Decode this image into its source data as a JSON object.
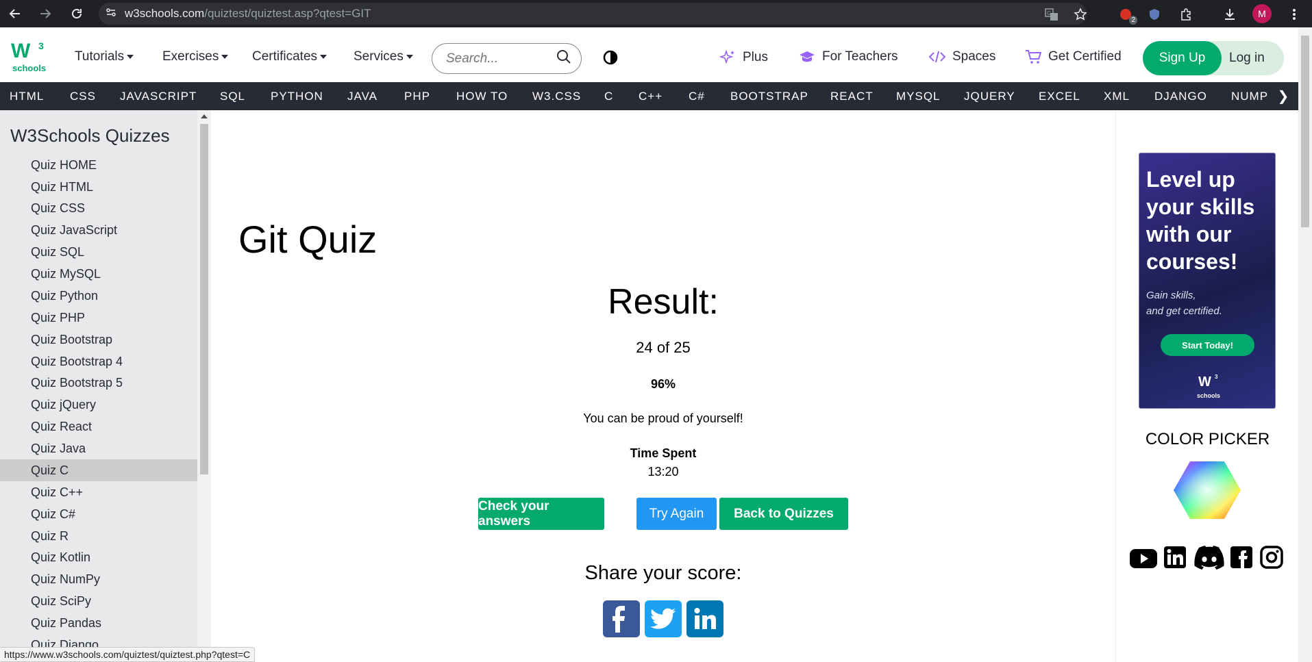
{
  "browser": {
    "url_host": "w3schools.com",
    "url_path": "/quiztest/quiztest.asp?qtest=GIT",
    "extension_badge": "2",
    "profile_initial": "M"
  },
  "topnav": {
    "logo_text": "schools",
    "logo_sup": "3",
    "menus": [
      "Tutorials",
      "Exercises",
      "Certificates",
      "Services"
    ],
    "search_placeholder": "Search...",
    "right_links": [
      "Plus",
      "For Teachers",
      "Spaces",
      "Get Certified"
    ],
    "signup": "Sign Up",
    "login": "Log in"
  },
  "subjects": [
    "HTML",
    "CSS",
    "JAVASCRIPT",
    "SQL",
    "PYTHON",
    "JAVA",
    "PHP",
    "HOW TO",
    "W3.CSS",
    "C",
    "C++",
    "C#",
    "BOOTSTRAP",
    "REACT",
    "MYSQL",
    "JQUERY",
    "EXCEL",
    "XML",
    "DJANGO",
    "NUMPY"
  ],
  "sidebar": {
    "title": "W3Schools Quizzes",
    "items": [
      "Quiz HOME",
      "Quiz HTML",
      "Quiz CSS",
      "Quiz JavaScript",
      "Quiz SQL",
      "Quiz MySQL",
      "Quiz Python",
      "Quiz PHP",
      "Quiz Bootstrap",
      "Quiz Bootstrap 4",
      "Quiz Bootstrap 5",
      "Quiz jQuery",
      "Quiz React",
      "Quiz Java",
      "Quiz C",
      "Quiz C++",
      "Quiz C#",
      "Quiz R",
      "Quiz Kotlin",
      "Quiz NumPy",
      "Quiz SciPy",
      "Quiz Pandas",
      "Quiz Django"
    ],
    "active_item": "Quiz C"
  },
  "main": {
    "title": "Git Quiz",
    "result_heading": "Result:",
    "score": "24 of 25",
    "percent": "96%",
    "message": "You can be proud of yourself!",
    "time_label": "Time Spent",
    "time_value": "13:20",
    "buttons": {
      "check": "Check your answers",
      "try_again": "Try Again",
      "back": "Back to Quizzes"
    },
    "share_heading": "Share your score:"
  },
  "ad": {
    "headline": "Level up your skills with our courses!",
    "sub_line1": "Gain skills,",
    "sub_line2": "and get certified.",
    "cta": "Start Today!",
    "logo_text": "schools"
  },
  "rail": {
    "color_picker_label": "COLOR PICKER"
  },
  "status_url": "https://www.w3schools.com/quiztest/quiztest.php?qtest=C",
  "colors": {
    "brand_green": "#04aa6d",
    "nav_dark": "#282a35",
    "try_again_blue": "#2196f3",
    "sidebar_bg": "#e7e9eb"
  }
}
